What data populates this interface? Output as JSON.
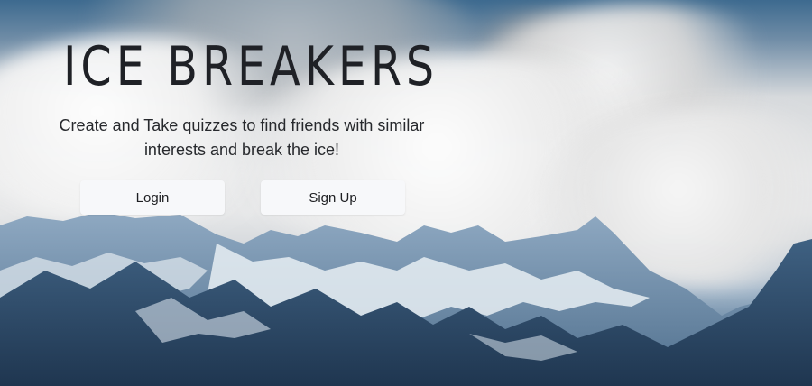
{
  "hero": {
    "title": "ICE BREAKERS",
    "tagline": "Create and Take quizzes to find friends with similar interests and break the ice!"
  },
  "actions": {
    "login_label": "Login",
    "signup_label": "Sign Up"
  },
  "colors": {
    "title_text": "#1f2126",
    "button_bg": "#f7f8fa",
    "sky": "#3d6a8f",
    "mountain_dark": "#2f4a64"
  }
}
